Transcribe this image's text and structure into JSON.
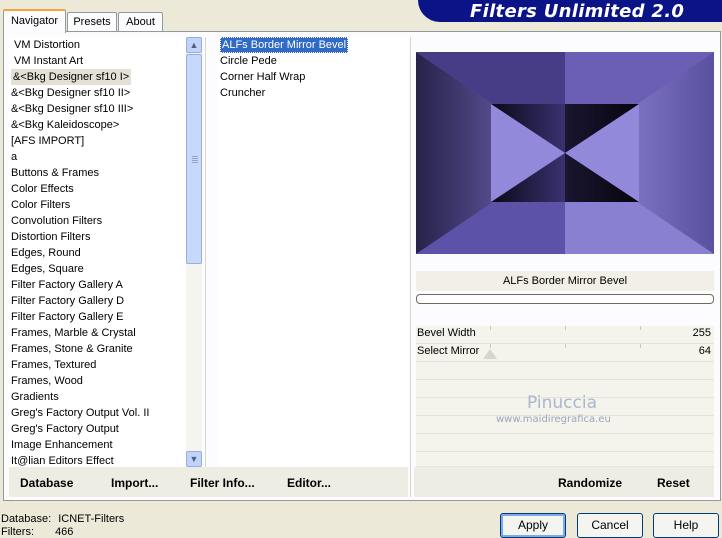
{
  "window": {
    "title": "Filters Unlimited 2.0"
  },
  "tabs": [
    {
      "label": "Navigator",
      "active": true
    },
    {
      "label": "Presets",
      "active": false
    },
    {
      "label": "About",
      "active": false
    }
  ],
  "categories": [
    "VM Distortion",
    "VM Instant Art",
    "&<Bkg Designer sf10 I>",
    "&<Bkg Designer sf10 II>",
    "&<Bkg Designer sf10 III>",
    "&<Bkg Kaleidoscope>",
    "[AFS IMPORT]",
    "a",
    "Buttons & Frames",
    "Color Effects",
    "Color Filters",
    "Convolution Filters",
    "Distortion Filters",
    "Edges, Round",
    "Edges, Square",
    "Filter Factory Gallery A",
    "Filter Factory Gallery D",
    "Filter Factory Gallery E",
    "Frames, Marble & Crystal",
    "Frames, Stone & Granite",
    "Frames, Textured",
    "Frames, Wood",
    "Gradients",
    "Greg's Factory Output Vol. II",
    "Greg's Factory Output",
    "Image Enhancement",
    "It@lian Editors Effect"
  ],
  "selected_category_index": 2,
  "filters": [
    "ALFs Border Mirror Bevel",
    "Circle Pede",
    "Corner Half Wrap",
    "Cruncher"
  ],
  "selected_filter_index": 0,
  "preview": {
    "filter_name": "ALFs Border Mirror Bevel",
    "progress": 0
  },
  "sliders": [
    {
      "label": "Bevel Width",
      "value": "255",
      "fraction": 1.0
    },
    {
      "label": "Select Mirror",
      "value": "64",
      "fraction": 0.25
    }
  ],
  "watermark": {
    "name": "Pinuccia",
    "site": "www.maidiregrafica.eu"
  },
  "bottom_buttons": {
    "database": "Database",
    "import": "Import...",
    "filter_info": "Filter Info...",
    "editor": "Editor...",
    "randomize": "Randomize",
    "reset": "Reset"
  },
  "status": {
    "database_label": "Database:",
    "database_value": "ICNET-Filters",
    "filters_label": "Filters:",
    "filters_value": "466"
  },
  "dialog_buttons": {
    "apply": "Apply",
    "cancel": "Cancel",
    "help": "Help"
  },
  "colors": {
    "banner": "#0a1486",
    "selection": "#316ac5",
    "preview_light": "#8f85d6",
    "preview_dark": "#1a1630"
  }
}
